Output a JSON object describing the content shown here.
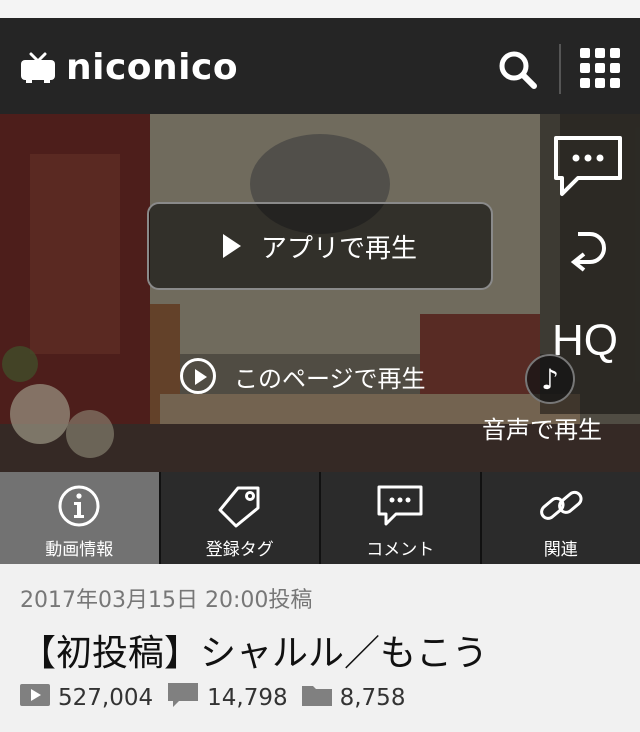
{
  "header": {
    "logo_text": "niconico",
    "search_icon": "search-icon",
    "menu_icon": "grid-menu-icon"
  },
  "player": {
    "app_play_label": "アプリで再生",
    "page_play_label": "このページで再生",
    "side_controls": {
      "comment_icon": "comment-bubble-icon",
      "loop_icon": "loop-arrow-icon",
      "hq_label": "HQ"
    },
    "audio_play": {
      "icon": "music-note-icon",
      "label": "音声で再生"
    }
  },
  "tabs": [
    {
      "label": "動画情報",
      "icon": "info-icon",
      "active": true
    },
    {
      "label": "登録タグ",
      "icon": "tag-icon",
      "active": false
    },
    {
      "label": "コメント",
      "icon": "comment-icon",
      "active": false
    },
    {
      "label": "関連",
      "icon": "link-icon",
      "active": false
    }
  ],
  "video": {
    "posted": "2017年03月15日 20:00投稿",
    "title": "【初投稿】シャルル／もこう",
    "views": "527,004",
    "comments": "14,798",
    "mylists": "8,758"
  },
  "colors": {
    "header_bg": "#252525",
    "tab_bg": "#2b2b2b",
    "tab_active_bg": "#727272",
    "info_bg": "#f1f1f1",
    "stat_icon": "#808080"
  }
}
